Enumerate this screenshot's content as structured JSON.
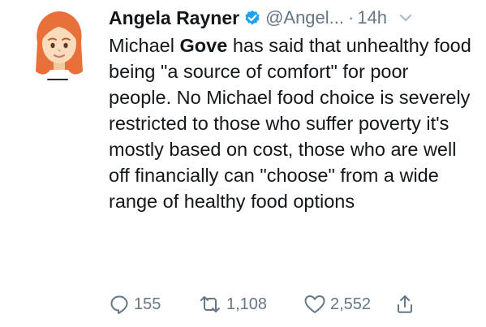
{
  "tweet": {
    "author": {
      "display_name": "Angela Rayner",
      "handle": "@Angel...",
      "verified": true,
      "avatar_icon": "red-haired-woman-emoji-icon"
    },
    "separator": "·",
    "time": "14h",
    "body": {
      "part1": "Michael ",
      "bold": "Gove",
      "part2": " has said that unhealthy food being \"a source of comfort\" for poor people. No Michael food choice is severely restricted to those who suffer poverty it's mostly based on cost, those who are well off financially can \"choose\" from a wide range of healthy food options"
    },
    "actions": {
      "reply_count": "155",
      "retweet_count": "1,108",
      "like_count": "2,552"
    }
  },
  "colors": {
    "text": "#14171a",
    "secondary": "#657786",
    "verified": "#1da1f2",
    "hair": "#e8703a",
    "skin": "#fadcbc"
  }
}
